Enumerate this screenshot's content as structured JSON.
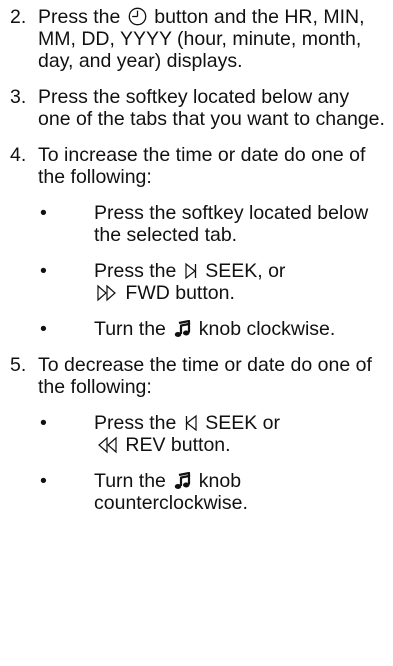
{
  "steps": [
    {
      "num": "2.",
      "pre": "Press the",
      "icon": "clock-icon",
      "post": "button and the HR, MIN, MM, DD, YYYY (hour, minute, month, day, and year) displays."
    },
    {
      "num": "3.",
      "text": "Press the softkey located below any one of the tabs that you want to change."
    },
    {
      "num": "4.",
      "text": "To increase the time or date do one of the following:",
      "items": [
        {
          "bullet": "•",
          "text": "Press the softkey located below the selected tab."
        },
        {
          "bullet": "•",
          "pre": "Press the",
          "icon": "seek-forward-icon",
          "mid": "SEEK, or",
          "icon2": "fast-forward-icon",
          "post": "FWD button."
        },
        {
          "bullet": "•",
          "pre": "Turn the",
          "icon": "music-note-icon",
          "post": "knob clockwise."
        }
      ]
    },
    {
      "num": "5.",
      "text": "To decrease the time or date do one of the following:",
      "items": [
        {
          "bullet": "•",
          "pre": "Press the",
          "icon": "seek-back-icon",
          "mid": "SEEK or",
          "icon2": "rewind-icon",
          "post": "REV button."
        },
        {
          "bullet": "•",
          "pre": "Turn the",
          "icon": "music-note-icon",
          "post": "knob counterclockwise."
        }
      ]
    }
  ]
}
